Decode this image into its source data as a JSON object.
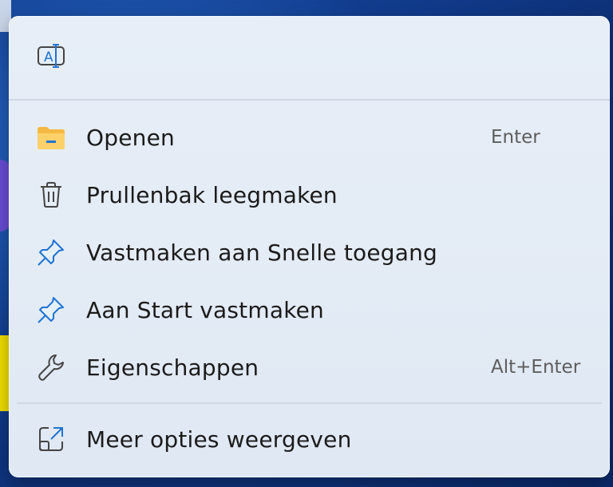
{
  "menu": {
    "top": {
      "rename_icon": "rename-icon"
    },
    "items": [
      {
        "label": "Openen",
        "shortcut": "Enter",
        "icon": "folder-icon"
      },
      {
        "label": "Prullenbak leegmaken",
        "shortcut": "",
        "icon": "trash-icon"
      },
      {
        "label": "Vastmaken aan Snelle toegang",
        "shortcut": "",
        "icon": "pin-icon"
      },
      {
        "label": "Aan Start vastmaken",
        "shortcut": "",
        "icon": "pin-icon"
      },
      {
        "label": "Eigenschappen",
        "shortcut": "Alt+Enter",
        "icon": "wrench-icon"
      }
    ],
    "more": {
      "label": "Meer opties weergeven",
      "icon": "open-external-icon"
    }
  },
  "colors": {
    "accent": "#1f74d3",
    "folder": "#f4b942"
  }
}
